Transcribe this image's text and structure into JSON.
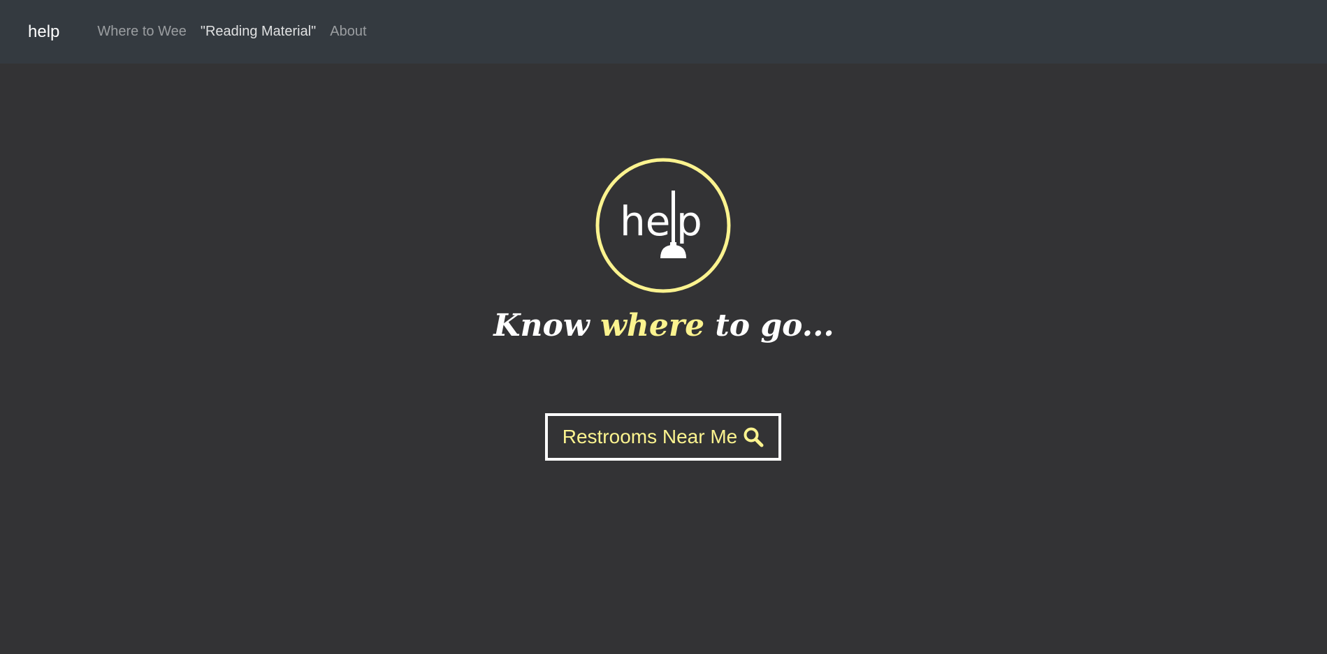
{
  "navbar": {
    "brand": "help",
    "links": [
      {
        "label": "Where to Wee",
        "active": false
      },
      {
        "label": "\"Reading Material\"",
        "active": true
      },
      {
        "label": "About",
        "active": false
      }
    ]
  },
  "hero": {
    "logo_text": {
      "he": "he",
      "p": "p"
    },
    "tagline": {
      "part1": "Know ",
      "part2": "where",
      "part3": " to go..."
    },
    "search_button_label": "Restrooms Near Me",
    "search_icon": "search-icon"
  },
  "colors": {
    "navbar_bg": "#343a40",
    "page_bg": "#333335",
    "accent_yellow": "#fbf38f",
    "white": "#ffffff"
  }
}
